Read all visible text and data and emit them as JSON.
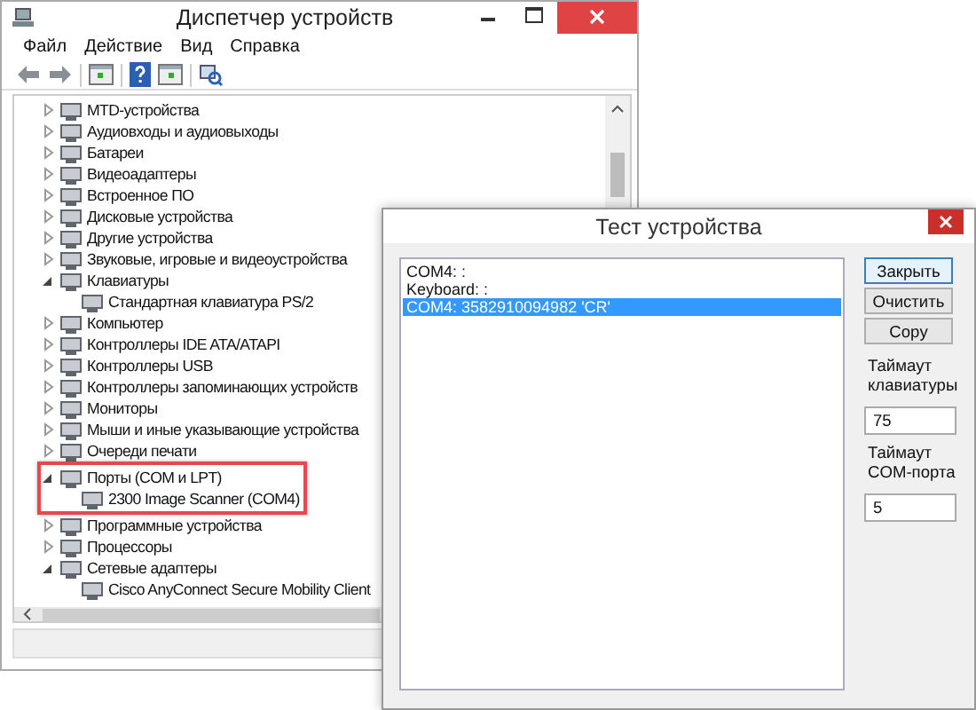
{
  "device_manager": {
    "title": "Диспетчер устройств",
    "menu": [
      "Файл",
      "Действие",
      "Вид",
      "Справка"
    ],
    "tree": [
      {
        "label": "MTD-устройства",
        "expanded": false,
        "highlighted": false
      },
      {
        "label": "Аудиовходы и аудиовыходы",
        "expanded": false,
        "highlighted": false
      },
      {
        "label": "Батареи",
        "expanded": false,
        "highlighted": false
      },
      {
        "label": "Видеоадаптеры",
        "expanded": false,
        "highlighted": false
      },
      {
        "label": "Встроенное ПО",
        "expanded": false,
        "highlighted": false
      },
      {
        "label": "Дисковые устройства",
        "expanded": false,
        "highlighted": false
      },
      {
        "label": "Другие устройства",
        "expanded": false,
        "highlighted": false
      },
      {
        "label": "Звуковые, игровые и видеоустройства",
        "expanded": false,
        "highlighted": false
      },
      {
        "label": "Клавиатуры",
        "expanded": true,
        "highlighted": false,
        "children": [
          {
            "label": "Стандартная клавиатура PS/2"
          }
        ]
      },
      {
        "label": "Компьютер",
        "expanded": false,
        "highlighted": false
      },
      {
        "label": "Контроллеры IDE ATA/ATAPI",
        "expanded": false,
        "highlighted": false
      },
      {
        "label": "Контроллеры USB",
        "expanded": false,
        "highlighted": false
      },
      {
        "label": "Контроллеры запоминающих устройств",
        "expanded": false,
        "highlighted": false
      },
      {
        "label": "Мониторы",
        "expanded": false,
        "highlighted": false
      },
      {
        "label": "Мыши и иные указывающие устройства",
        "expanded": false,
        "highlighted": false
      },
      {
        "label": "Очереди печати",
        "expanded": false,
        "highlighted": false
      },
      {
        "label": "Порты (COM и LPT)",
        "expanded": true,
        "highlighted": true,
        "children": [
          {
            "label": "2300 Image Scanner (COM4)"
          }
        ]
      },
      {
        "label": "Программные устройства",
        "expanded": false,
        "highlighted": false
      },
      {
        "label": "Процессоры",
        "expanded": false,
        "highlighted": false
      },
      {
        "label": "Сетевые адаптеры",
        "expanded": true,
        "highlighted": false,
        "children": [
          {
            "label": "Cisco AnyConnect Secure Mobility Client"
          }
        ]
      }
    ]
  },
  "test_dialog": {
    "title": "Тест устройства",
    "log": [
      {
        "text": "COM4: :",
        "selected": false
      },
      {
        "text": "Keyboard: :",
        "selected": false
      },
      {
        "text": "COM4: 3582910094982 'CR'",
        "selected": true
      }
    ],
    "buttons": [
      "Закрыть",
      "Очистить",
      "Copy"
    ],
    "keyboard_timeout": {
      "label": "Таймаут клавиатуры",
      "value": "75"
    },
    "com_timeout": {
      "label": "Таймаут COM-порта",
      "value": "5"
    }
  }
}
